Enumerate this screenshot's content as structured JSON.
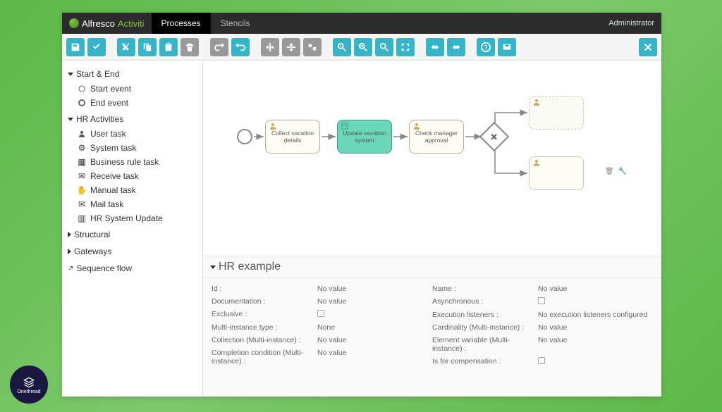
{
  "header": {
    "brand1": "Alfresco",
    "brand2": "Activiti",
    "tabs": [
      {
        "label": "Processes",
        "active": true
      },
      {
        "label": "Stencils",
        "active": false
      }
    ],
    "user": "Administrator"
  },
  "palette": {
    "groups": [
      {
        "label": "Start & End",
        "expanded": true,
        "items": [
          {
            "label": "Start event",
            "icon": "circle"
          },
          {
            "label": "End event",
            "icon": "circle-thick"
          }
        ]
      },
      {
        "label": "HR Activities",
        "expanded": true,
        "items": [
          {
            "label": "User task",
            "icon": "user"
          },
          {
            "label": "System task",
            "icon": "gear"
          },
          {
            "label": "Business rule task",
            "icon": "table"
          },
          {
            "label": "Receive task",
            "icon": "inbox"
          },
          {
            "label": "Manual task",
            "icon": "hand"
          },
          {
            "label": "Mail task",
            "icon": "mail"
          },
          {
            "label": "HR System Update",
            "icon": "calendar"
          }
        ]
      },
      {
        "label": "Structural",
        "expanded": false,
        "items": []
      },
      {
        "label": "Gateways",
        "expanded": false,
        "items": []
      },
      {
        "label": "Sequence flow",
        "expanded": false,
        "items": [],
        "leafIcon": "arrow"
      }
    ]
  },
  "canvas": {
    "tasks": [
      {
        "label": "Collect vacation details"
      },
      {
        "label": "Update vacation system"
      },
      {
        "label": "Check manager approval"
      }
    ]
  },
  "properties": {
    "title": "HR example",
    "left": [
      {
        "label": "Id :",
        "value": "No value"
      },
      {
        "label": "Documentation :",
        "value": "No value"
      },
      {
        "label": "Exclusive :",
        "value": "__check"
      },
      {
        "label": "Multi-instance type :",
        "value": "None"
      },
      {
        "label": "Collection (Multi-instance) :",
        "value": "No value"
      },
      {
        "label": "Completion condition (Multi-instance) :",
        "value": "No value"
      }
    ],
    "right": [
      {
        "label": "Name :",
        "value": "No value"
      },
      {
        "label": "Asynchronous :",
        "value": "__check"
      },
      {
        "label": "Execution listeners :",
        "value": "No execution listeners configured"
      },
      {
        "label": "Cardinality (Multi-instance) :",
        "value": "No value"
      },
      {
        "label": "Element variable (Multi-instance) :",
        "value": "No value"
      },
      {
        "label": "Is for compensation :",
        "value": "__check"
      }
    ]
  },
  "badge": {
    "label": "Onethread"
  }
}
